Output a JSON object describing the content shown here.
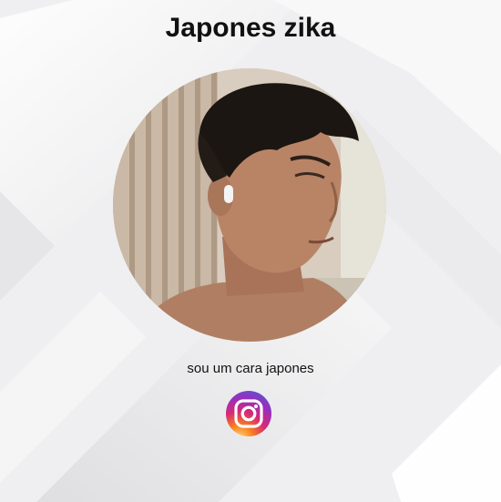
{
  "profile": {
    "name": "Japones zika",
    "bio": "sou um cara japones"
  },
  "social": {
    "instagram_icon": "instagram-icon"
  },
  "colors": {
    "background": "#f1f1f2",
    "title": "#111111",
    "instagram_gradient": [
      "#feda75",
      "#fa7e1e",
      "#d62976",
      "#962fbf",
      "#4f5bd5"
    ]
  }
}
